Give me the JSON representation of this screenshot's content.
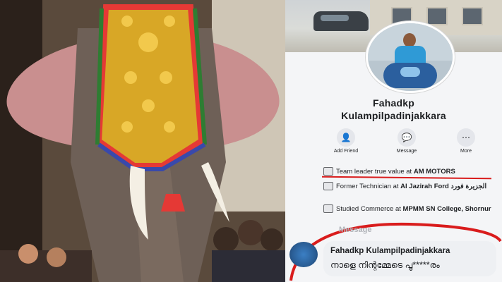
{
  "profile": {
    "name_line1": "Fahadkp",
    "name_line2": "Kulampilpadinjakkara",
    "actions": [
      {
        "label": "Add Friend",
        "icon": "add-friend-icon"
      },
      {
        "label": "Message",
        "icon": "messenger-icon"
      },
      {
        "label": "More",
        "icon": "more-icon"
      }
    ],
    "info": [
      {
        "prefix": "Team leader true value at ",
        "bold": "AM MOTORS"
      },
      {
        "prefix": "Former Technician at ",
        "bold": "Al Jazirah Ford الجزيرة فورد"
      },
      {
        "prefix": "Studied Commerce at ",
        "bold": "MPMM SN College",
        "suffix": ", Shornur"
      }
    ],
    "message_header": "Message"
  },
  "comment": {
    "author": "Fahadkp Kulampilpadinjakkara",
    "text": "നാളെ നിന്റമ്മേടെ പൂ*****രം"
  },
  "colors": {
    "highlight_red": "#d91c1c",
    "bubble": "#eef0f3",
    "text": "#1c1e21"
  }
}
